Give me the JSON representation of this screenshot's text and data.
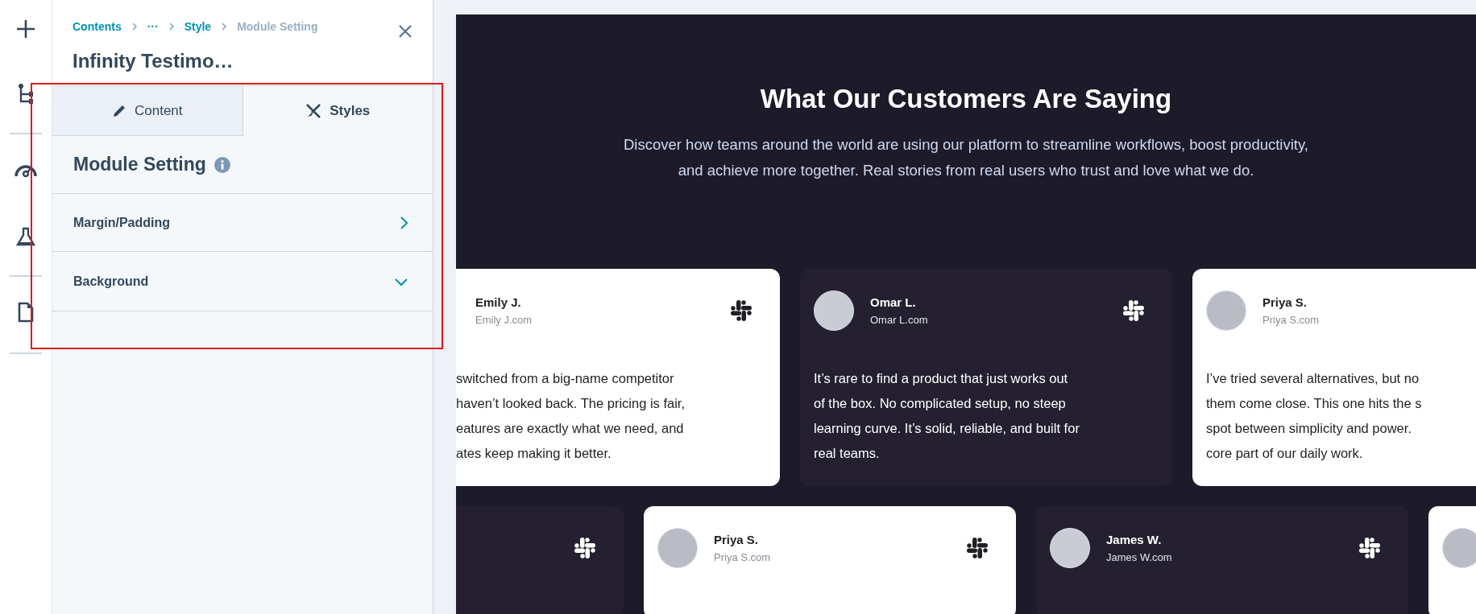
{
  "panel": {
    "breadcrumb": [
      {
        "label": "Contents",
        "current": false
      },
      {
        "label": "···",
        "current": false
      },
      {
        "label": "Style",
        "current": false
      },
      {
        "label": "Module Setting",
        "current": true
      }
    ],
    "title": "Infinity Testimo…",
    "tabs": [
      {
        "label": "Content",
        "kind": "pencil",
        "selected": false
      },
      {
        "label": "Styles",
        "kind": "brush",
        "selected": true
      }
    ],
    "section_title": "Module Setting",
    "settings": [
      {
        "label": "Margin/Padding",
        "expanded": false
      },
      {
        "label": "Background",
        "expanded": true
      }
    ]
  },
  "preview": {
    "heading": "What Our Customers Are Saying",
    "subtitle": "Discover how teams around the world are using our platform to streamline workflows, boost productivity, and achieve more together. Real stories from real users who trust and love what we do.",
    "rows": [
      {
        "cards": [
          {
            "kind": "light",
            "avatar": false,
            "logo": true,
            "name": "Emily J.",
            "site": "Emily J.com",
            "quote_lines": [
              "switched from a big-name competitor",
              "haven’t looked back. The pricing is fair,",
              "eatures are exactly what we need, and",
              "ates keep making it better."
            ]
          },
          {
            "kind": "dark",
            "avatar": true,
            "logo": true,
            "name": "Omar L.",
            "site": "Omar L.com",
            "quote_lines": [
              "It’s rare to find a product that just works out",
              "of the box. No complicated setup, no steep",
              "learning curve. It’s solid, reliable, and built for",
              "real teams."
            ]
          },
          {
            "kind": "light",
            "avatar": true,
            "logo": false,
            "name": "Priya S.",
            "site": "Priya S.com",
            "quote_lines": [
              "I’ve tried several alternatives, but no",
              "them come close. This one hits the s",
              "spot between simplicity and power.",
              "core part of our daily work."
            ]
          }
        ]
      },
      {
        "cards": [
          {
            "kind": "dark",
            "avatar": false,
            "logo": true
          },
          {
            "kind": "light",
            "avatar": true,
            "logo": true,
            "name": "Priya S.",
            "site": "Priya S.com"
          },
          {
            "kind": "dark",
            "avatar": true,
            "logo": true,
            "name": "James W.",
            "site": "James W.com"
          },
          {
            "kind": "light",
            "avatar": true,
            "logo": false
          }
        ]
      }
    ]
  }
}
